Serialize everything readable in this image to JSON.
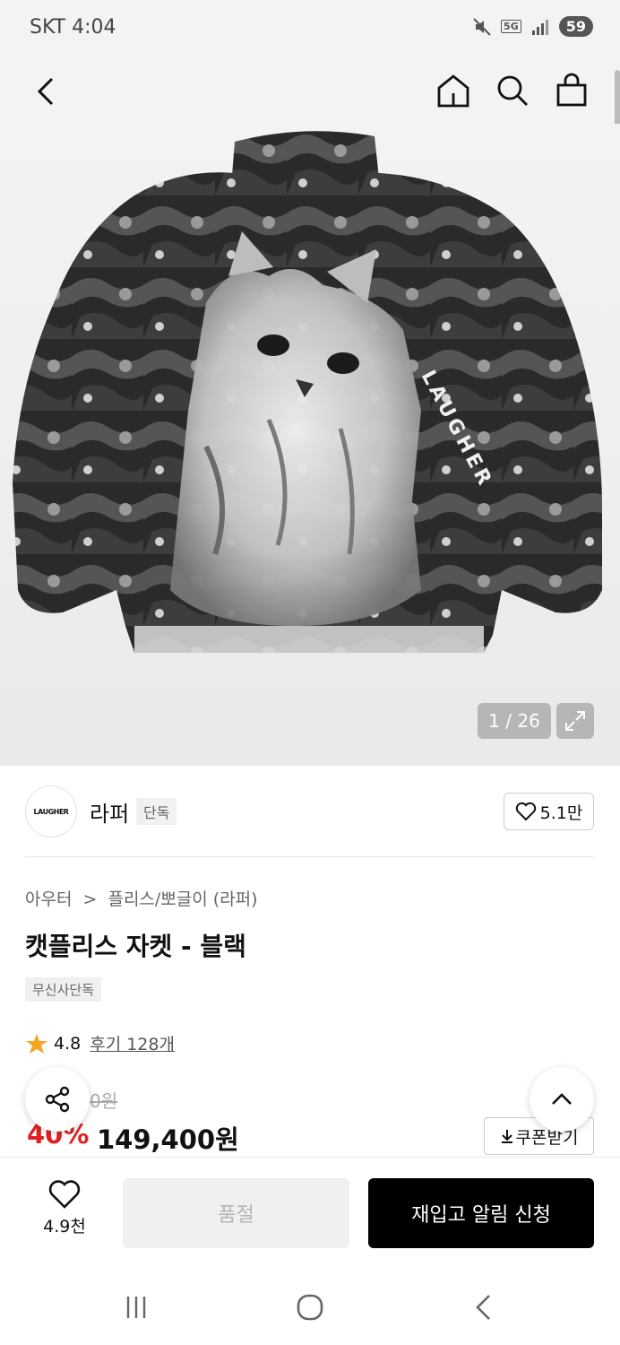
{
  "status": {
    "carrier_time": "SKT 4:04",
    "network": "5G",
    "battery": "59"
  },
  "product": {
    "image_counter": "1 / 26",
    "jacket_print_text": "LAUGHER"
  },
  "brand": {
    "logo_text": "LAUGHER",
    "name": "라퍼",
    "tag": "단독",
    "likes": "5.1만"
  },
  "breadcrumb": {
    "category": "아우터",
    "separator": ">",
    "subcategory": "플리스/뽀글이 (라퍼)"
  },
  "title": "캣플리스 자켓 - 블랙",
  "exclusive_chip": "무신사단독",
  "rating": {
    "score": "4.8",
    "reviews": "후기 128개"
  },
  "price": {
    "original_visible": "0원",
    "discount_visible": "40%",
    "sale": "149,400원",
    "coupon_label": "쿠폰받기"
  },
  "purchase_bar": {
    "wish_count": "4.9천",
    "soldout_label": "품절",
    "restock_label": "재입고 알림 신청"
  },
  "colors": {
    "accent_red": "#e02020",
    "cta_black": "#000000"
  }
}
